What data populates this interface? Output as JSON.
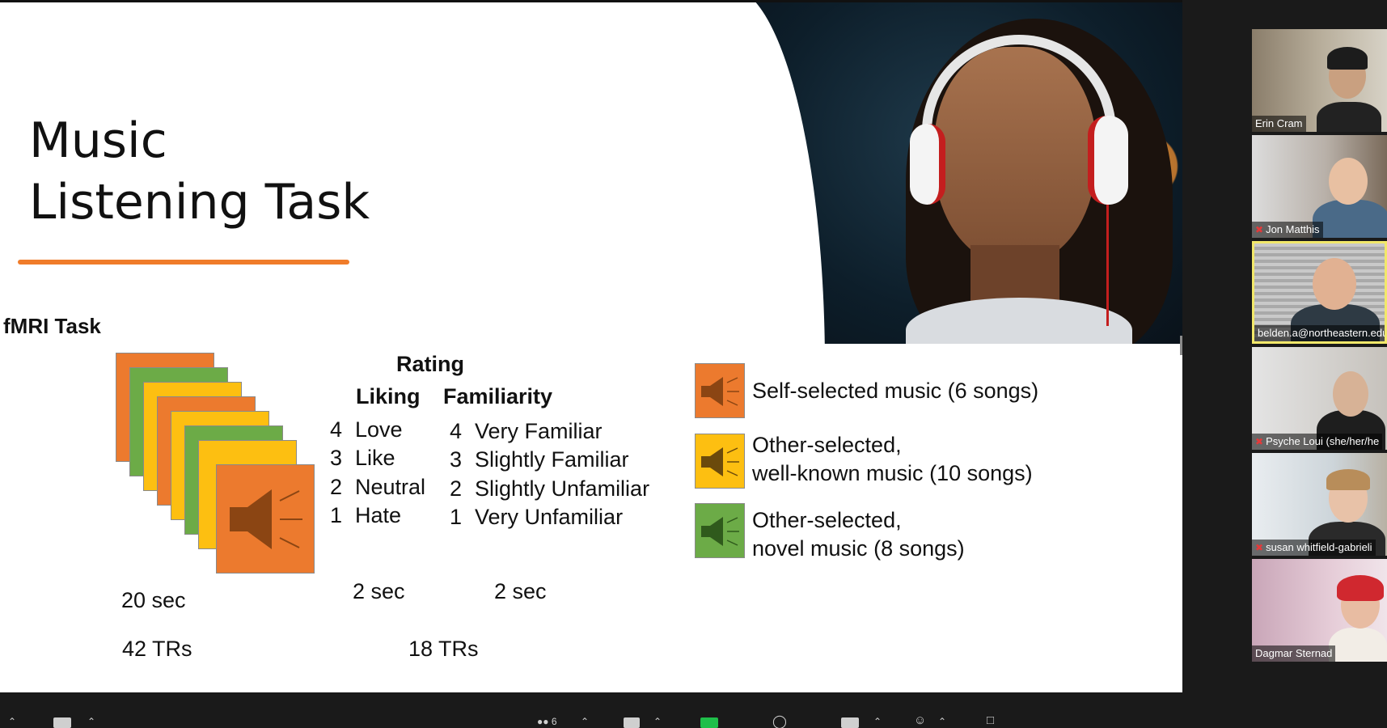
{
  "slide": {
    "title_line1": "Music",
    "title_line2": "Listening Task",
    "section_label": "fMRI Task",
    "rating_header": "Rating",
    "liking_header": "Liking",
    "familiarity_header": "Familiarity",
    "liking": [
      {
        "n": "4",
        "label": "Love"
      },
      {
        "n": "3",
        "label": "Like"
      },
      {
        "n": "2",
        "label": "Neutral"
      },
      {
        "n": "1",
        "label": "Hate"
      }
    ],
    "familiarity": [
      {
        "n": "4",
        "label": "Very Familiar"
      },
      {
        "n": "3",
        "label": "Slightly Familiar"
      },
      {
        "n": "2",
        "label": "Slightly Unfamiliar"
      },
      {
        "n": "1",
        "label": "Very Unfamiliar"
      }
    ],
    "stim_duration": "20 sec",
    "liking_duration": "2 sec",
    "familiarity_duration": "2 sec",
    "stim_trs": "42 TRs",
    "rating_trs": "18 TRs",
    "legend": [
      {
        "line1": "Self-selected music",
        "count": "(6 songs)",
        "line2": "",
        "color": "#ec7a2e"
      },
      {
        "line1": "Other-selected,",
        "line2": "well-known music",
        "count": "(10 songs)",
        "color": "#fdbf11"
      },
      {
        "line1": "Other-selected,",
        "line2": "novel music",
        "count": "(8 songs)",
        "color": "#6cab47"
      }
    ],
    "colors": {
      "orange": "#ec7a2e",
      "green": "#6cab47",
      "yellow": "#fdbf11",
      "underline": "#f07c2a"
    }
  },
  "participants": [
    {
      "name": "Erin Cram",
      "muted": false
    },
    {
      "name": "Jon Matthis",
      "muted": true
    },
    {
      "name": "belden.a@northeastern.edu",
      "muted": false,
      "active": true
    },
    {
      "name": "Psyche Loui (she/her/he",
      "muted": true
    },
    {
      "name": "susan whitfield-gabrieli",
      "muted": true
    },
    {
      "name": "Dagmar Sternad",
      "muted": false
    }
  ],
  "toolbar": {
    "participants_count": "6",
    "icons": [
      "audio-icon",
      "video-icon",
      "participants-icon",
      "chat-icon",
      "share-screen-icon",
      "record-icon",
      "captions-icon",
      "reactions-icon",
      "apps-icon"
    ]
  }
}
